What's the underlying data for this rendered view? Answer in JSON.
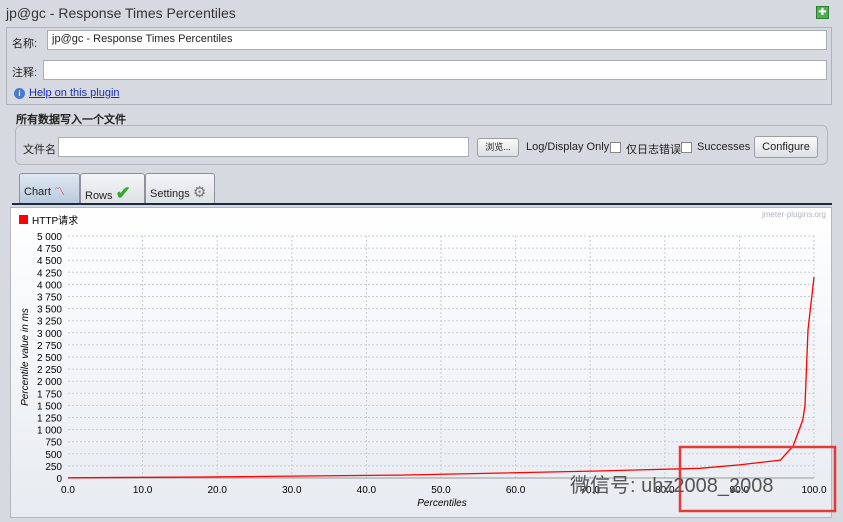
{
  "window": {
    "title": "jp@gc - Response Times Percentiles",
    "maximize_icon": "maximize-icon"
  },
  "form": {
    "name_label": "名称:",
    "name_value": "jp@gc - Response Times Percentiles",
    "comment_label": "注释:",
    "comment_value": "",
    "help_link": "Help on this plugin"
  },
  "file_section": {
    "title": "所有数据写入一个文件",
    "filename_label": "文件名",
    "filename_value": "",
    "browse_button": "浏览...",
    "log_display_label": "Log/Display Only:",
    "errors_only_label": "仅日志错误",
    "errors_only_checked": false,
    "successes_label": "Successes",
    "successes_checked": false,
    "configure_button": "Configure"
  },
  "tabs": [
    {
      "label": "Chart",
      "active": true
    },
    {
      "label": "Rows",
      "active": false
    },
    {
      "label": "Settings",
      "active": false
    }
  ],
  "watermark": "jmeter-plugins.org",
  "overlay_text": "微信号: uhz2008_2008",
  "chart_data": {
    "type": "line",
    "xlabel": "Percentiles",
    "ylabel": "Percentile value in ms",
    "xlim": [
      0,
      100
    ],
    "ylim": [
      0,
      5000
    ],
    "x_ticks": [
      "0.0",
      "10.0",
      "20.0",
      "30.0",
      "40.0",
      "50.0",
      "60.0",
      "70.0",
      "80.0",
      "90.0",
      "100.0"
    ],
    "y_ticks": [
      "0",
      "250",
      "500",
      "750",
      "1 000",
      "1 250",
      "1 500",
      "1 750",
      "2 000",
      "2 250",
      "2 500",
      "2 750",
      "3 000",
      "3 250",
      "3 500",
      "3 750",
      "4 000",
      "4 250",
      "4 500",
      "4 750",
      "5 000"
    ],
    "grid": true,
    "legend_position": "top-left",
    "series": [
      {
        "name": "HTTP请求",
        "color": "#ff0000",
        "x": [
          0,
          17.7,
          44.5,
          71,
          84.7,
          90,
          95.5,
          97.2,
          98.5,
          98.8,
          99.2,
          100
        ],
        "y": [
          5,
          20,
          60,
          145,
          200,
          270,
          370,
          660,
          1200,
          1500,
          3060,
          4150
        ]
      }
    ]
  }
}
